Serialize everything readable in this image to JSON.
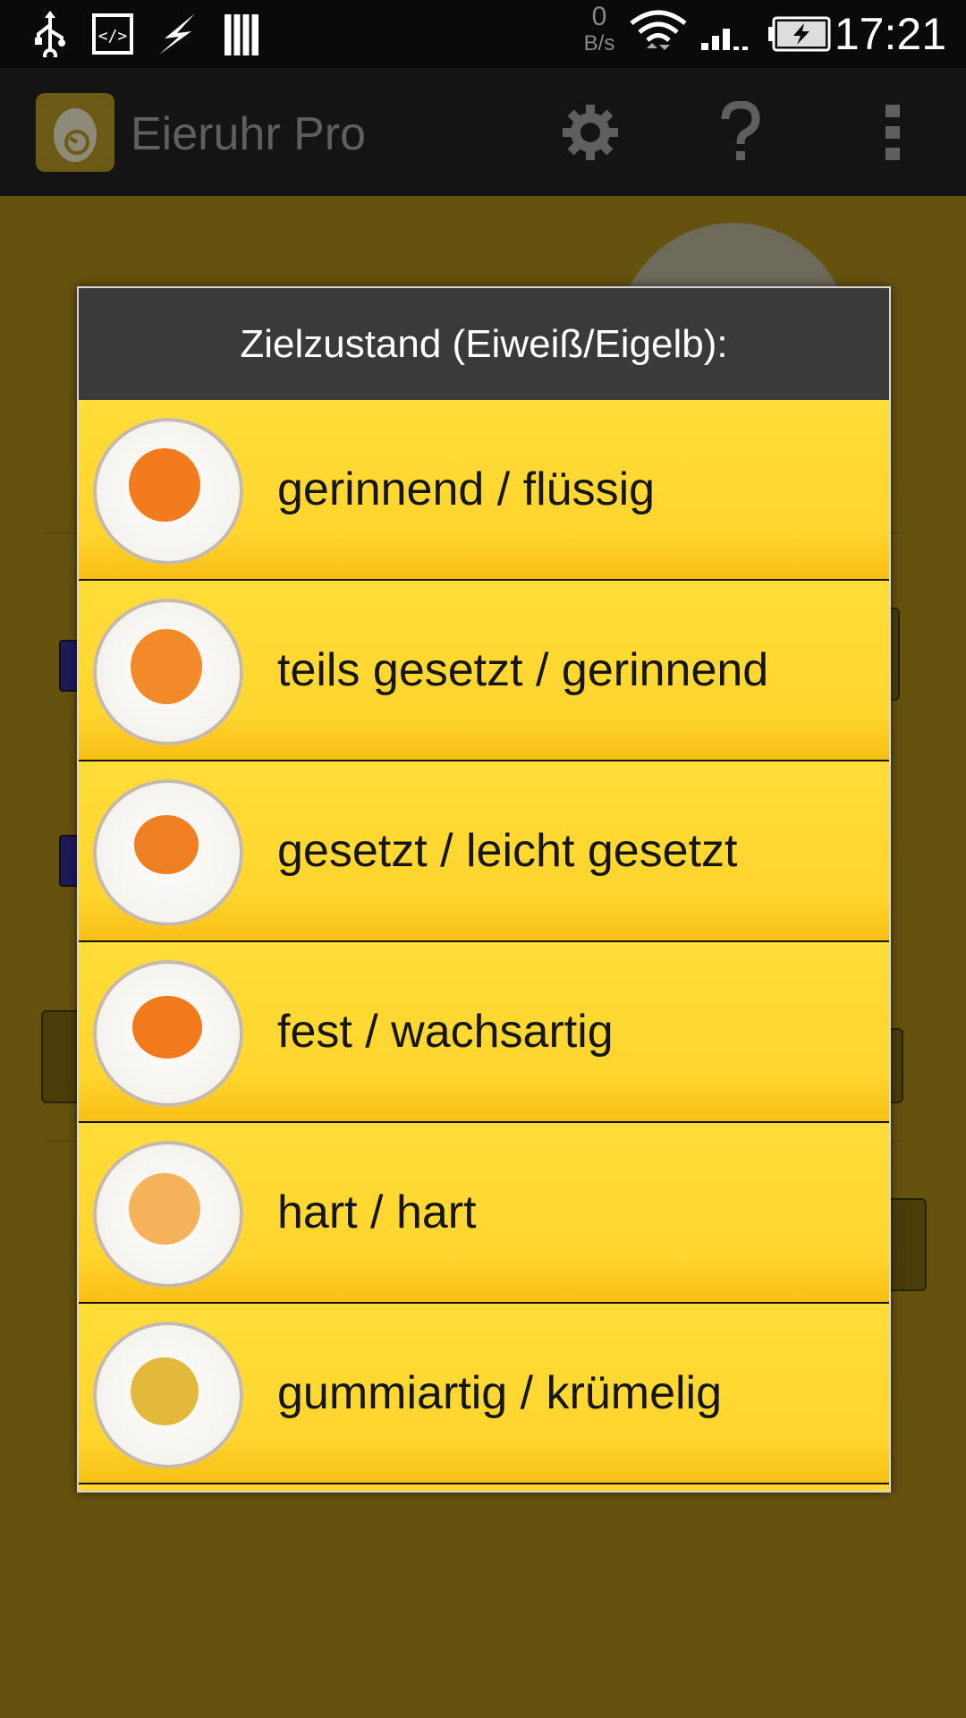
{
  "status_bar": {
    "time": "17:21",
    "net_rate_value": "0",
    "net_rate_unit": "B/s",
    "icons": [
      "usb-icon",
      "debug-icon",
      "flash-icon",
      "sim-icon",
      "wifi-icon",
      "signal-icon",
      "battery-charging-icon"
    ]
  },
  "action_bar": {
    "title": "Eieruhr Pro",
    "icons": [
      "app-egg-icon",
      "settings-gear-icon",
      "help-icon",
      "overflow-menu-icon"
    ]
  },
  "dialog": {
    "title": "Zielzustand (Eiweiß/Eigelb):",
    "options": [
      {
        "label": "gerinnend / flüssig",
        "yolk_color": "#f47a1e"
      },
      {
        "label": "teils gesetzt / gerinnend",
        "yolk_color": "#f28a2a"
      },
      {
        "label": "gesetzt / leicht gesetzt",
        "yolk_color": "#ef7f20"
      },
      {
        "label": "fest / wachsartig",
        "yolk_color": "#f07a1c"
      },
      {
        "label": "hart / hart",
        "yolk_color": "#f5b25a"
      },
      {
        "label": "gummiartig / krümelig",
        "yolk_color": "#e2b93a"
      }
    ]
  },
  "colors": {
    "dialog_item_bg": "#ffd52e",
    "dialog_title_bg": "#3a3a3a",
    "dimmed_background": "#66520f"
  }
}
